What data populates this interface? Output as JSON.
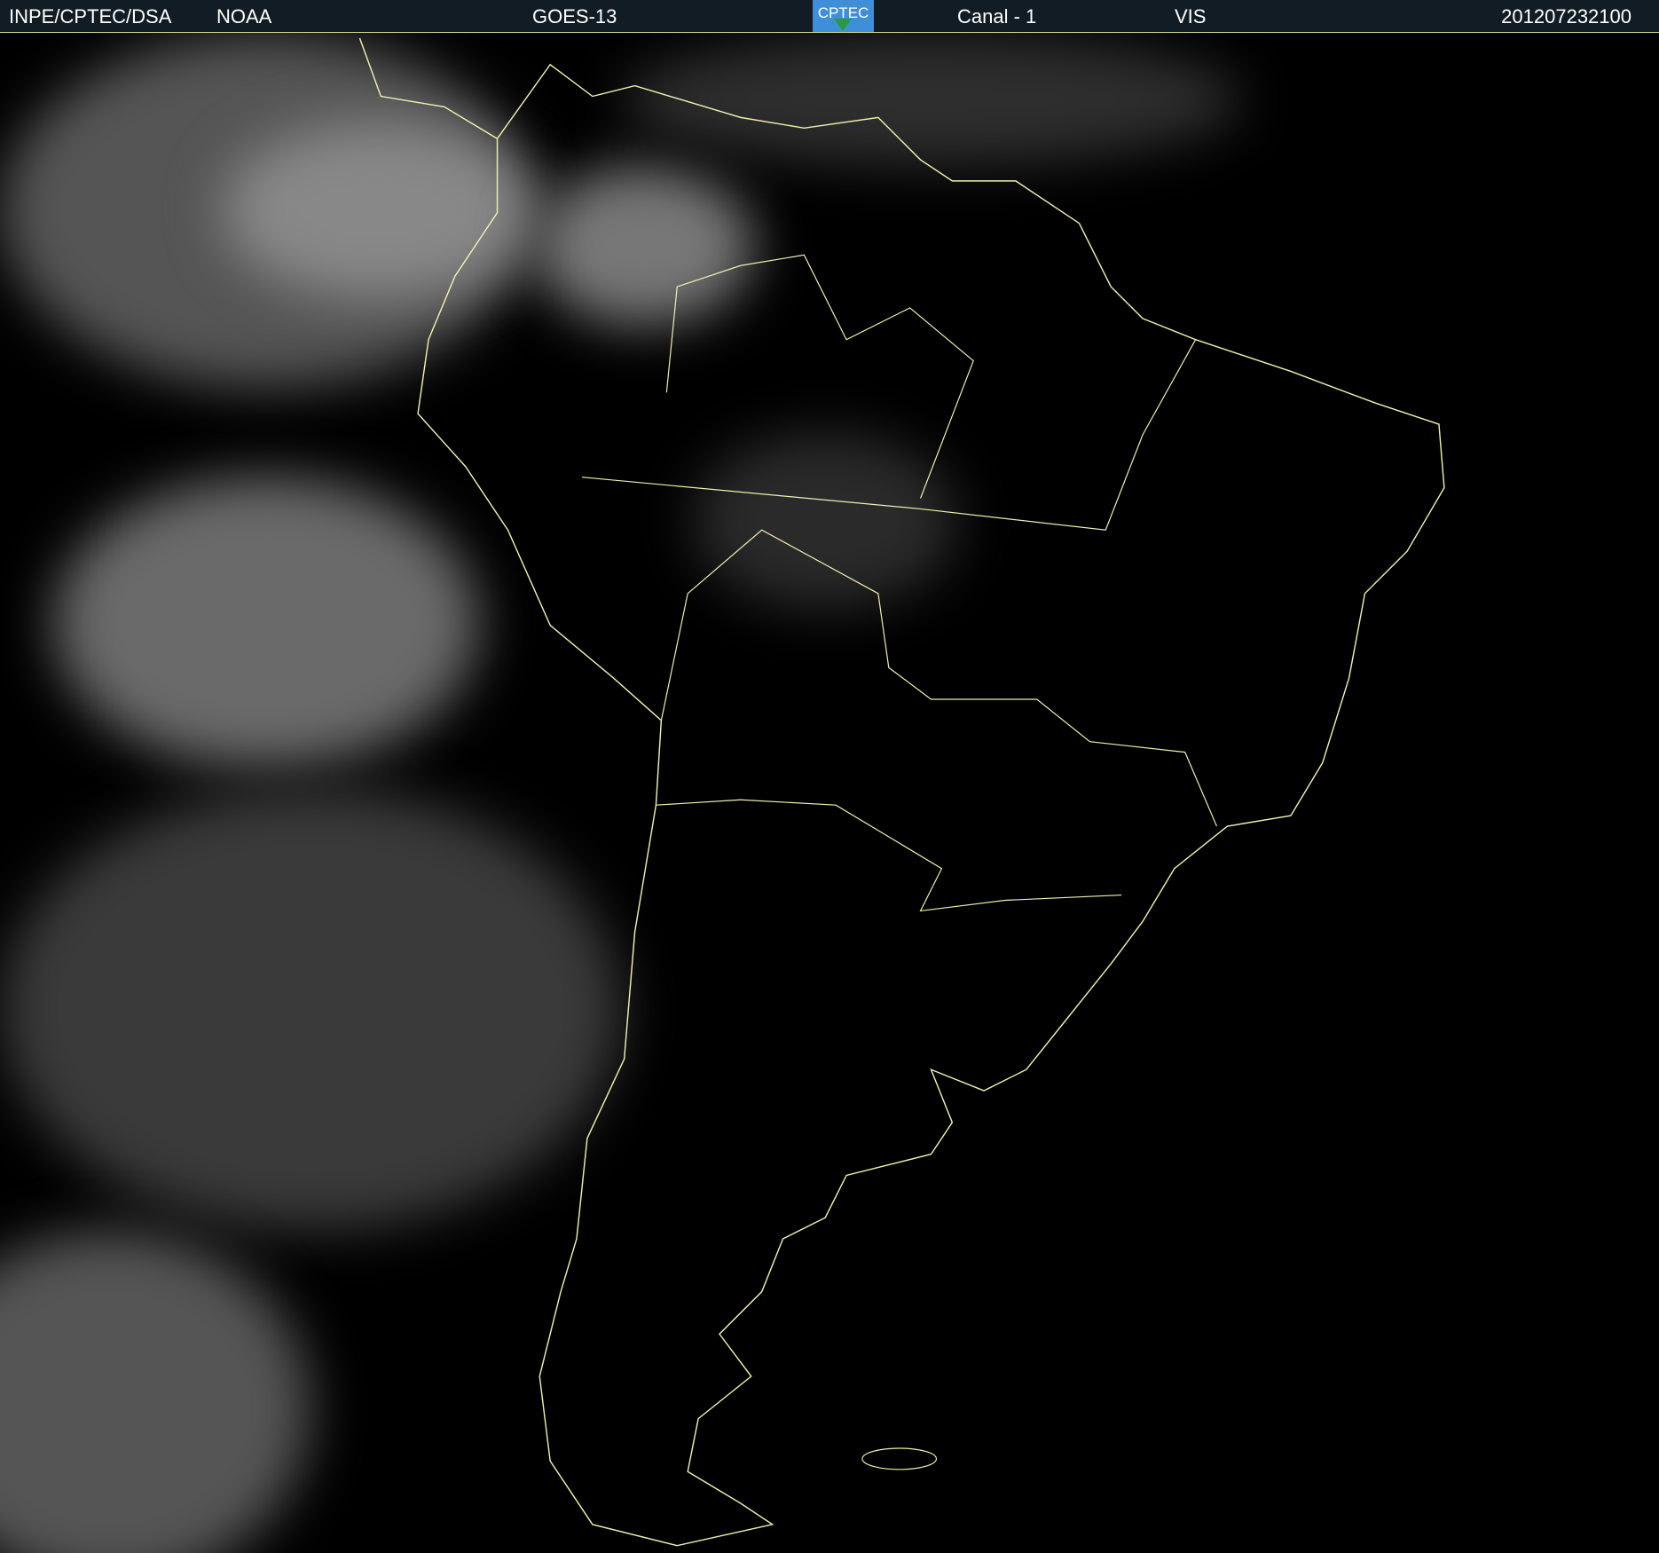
{
  "header": {
    "agency": "INPE/CPTEC/DSA",
    "provider": "NOAA",
    "satellite": "GOES-13",
    "logo_text": "CPTEC",
    "channel": "Canal - 1",
    "band": "VIS",
    "timestamp": "201207232100"
  },
  "colors": {
    "header_bg": "#111c24",
    "border_lines": "#f0f0b0",
    "logo_bg": "#3f8fd8"
  }
}
